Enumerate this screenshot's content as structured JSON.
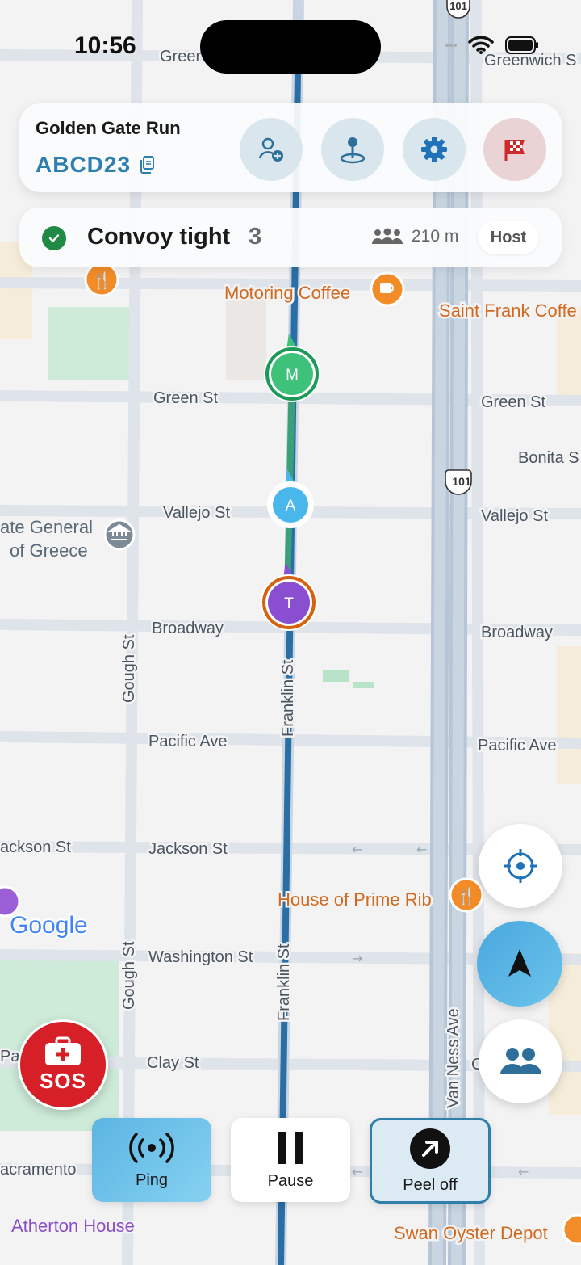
{
  "status_bar": {
    "time": "10:56"
  },
  "trip": {
    "name": "Golden Gate Run",
    "code": "ABCD23",
    "actions": [
      {
        "id": "add-member",
        "icon": "add-person-icon"
      },
      {
        "id": "set-destination",
        "icon": "map-pin-icon"
      },
      {
        "id": "settings",
        "icon": "gear-icon"
      },
      {
        "id": "finish",
        "icon": "checkered-flag-icon"
      }
    ]
  },
  "convoy": {
    "status": "Convoy tight",
    "count": "3",
    "spread": "210 m",
    "role": "Host",
    "status_color": "#1f8a44"
  },
  "map": {
    "streets": {
      "green_top": "Greer",
      "greenwich": "Greenwich S",
      "green": "Green St",
      "green_east": "Green St",
      "bonita": "Bonita S",
      "vallejo": "Vallejo St",
      "vallejo_east": "Vallejo St",
      "broadway": "Broadway",
      "broadway_east": "Broadway",
      "pacific": "Pacific Ave",
      "pacific_east": "Pacific Ave",
      "jackson_west": "ackson St",
      "jackson": "Jackson St",
      "washington": "Washington St",
      "clay": "Clay St",
      "sacramento": "acramento",
      "gough_top": "Gough St",
      "gough_bottom": "Gough St",
      "franklin_top": "Franklin St",
      "franklin_bottom": "Franklin St",
      "van_ness": "Van Ness Ave",
      "pa": "Pa",
      "c": "C"
    },
    "highway_shield": "101",
    "pois": {
      "motoring_coffee": "Motoring Coffee",
      "saint_frank": "Saint Frank Coffe",
      "consulate_line1": "ate General",
      "consulate_line2": "of Greece",
      "prime_rib": "House of Prime Rib",
      "atherton": "Atherton House",
      "swan": "Swan Oyster Depot"
    },
    "attribution": "Google",
    "markers": [
      {
        "initial": "M",
        "color": "#3ec27a",
        "ring": "#1b9a57"
      },
      {
        "initial": "A",
        "color": "#4ab7ec",
        "ring": "#ffffff"
      },
      {
        "initial": "T",
        "color": "#8a4fd1",
        "ring": "#d4620f"
      }
    ]
  },
  "controls": {
    "recenter": "crosshair-icon",
    "compass": "navigation-arrow-icon",
    "members": "group-icon",
    "sos_label": "SOS"
  },
  "actions": {
    "ping_label": "Ping",
    "pause_label": "Pause",
    "peel_label": "Peel off"
  }
}
